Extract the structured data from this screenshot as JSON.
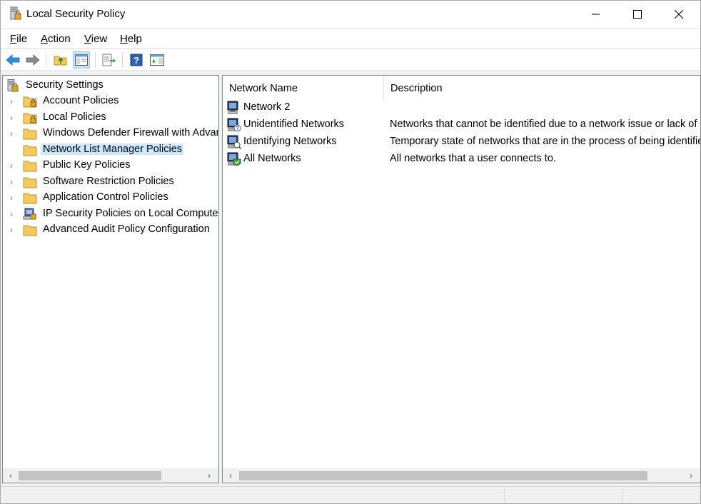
{
  "window": {
    "title": "Local Security Policy"
  },
  "menu": [
    {
      "label": "File",
      "key": "F",
      "rest": "ile"
    },
    {
      "label": "Action",
      "key": "A",
      "rest": "ction"
    },
    {
      "label": "View",
      "key": "V",
      "rest": "iew"
    },
    {
      "label": "Help",
      "key": "H",
      "rest": "elp"
    }
  ],
  "toolbar": {
    "buttons": [
      "back-icon",
      "forward-icon",
      "up-folder-icon",
      "show-hide-console-tree-icon",
      "export-list-icon",
      "help-icon",
      "properties-pane-icon"
    ],
    "active": "show-hide-console-tree-icon"
  },
  "tree": {
    "root": "Security Settings",
    "items": [
      {
        "label": "Account Policies",
        "icon": "locked-folder-icon"
      },
      {
        "label": "Local Policies",
        "icon": "locked-folder-icon"
      },
      {
        "label": "Windows Defender Firewall with Advanced Security",
        "icon": "folder-icon"
      },
      {
        "label": "Network List Manager Policies",
        "icon": "folder-icon",
        "selected": true
      },
      {
        "label": "Public Key Policies",
        "icon": "folder-icon"
      },
      {
        "label": "Software Restriction Policies",
        "icon": "folder-icon"
      },
      {
        "label": "Application Control Policies",
        "icon": "folder-icon"
      },
      {
        "label": "IP Security Policies on Local Computer",
        "icon": "ip-security-icon"
      },
      {
        "label": "Advanced Audit Policy Configuration",
        "icon": "folder-icon"
      }
    ]
  },
  "list": {
    "columns": {
      "name": "Network Name",
      "description": "Description"
    },
    "rows": [
      {
        "name": "Network 2",
        "description": "",
        "icon": "network-icon"
      },
      {
        "name": "Unidentified Networks",
        "description": "Networks that cannot be identified due to a network issue or lack of",
        "icon": "unidentified-network-icon"
      },
      {
        "name": "Identifying Networks",
        "description": "Temporary state of networks that are in the process of being identified",
        "icon": "identifying-network-icon"
      },
      {
        "name": "All Networks",
        "description": "All networks that a user connects to.",
        "icon": "all-networks-icon"
      }
    ]
  },
  "colors": {
    "selection": "#cce8ff",
    "toolbar_active": "#cce4f7",
    "folder": "#f4c95d"
  }
}
